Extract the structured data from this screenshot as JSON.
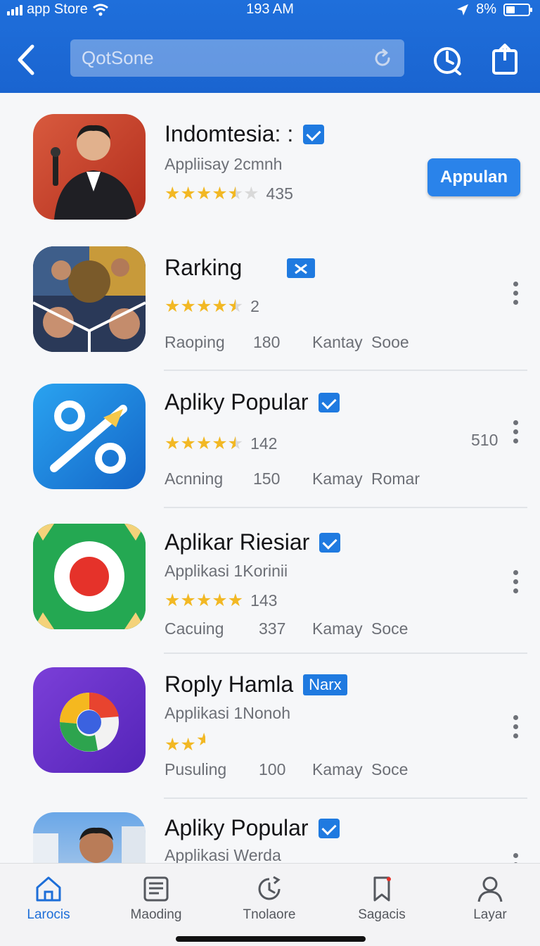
{
  "status_bar": {
    "carrier": "app Store",
    "time": "193 AM",
    "battery": "8%"
  },
  "header": {
    "search_placeholder": "QotSone"
  },
  "apps": [
    {
      "title": "Indomtesia: :",
      "subtitle": "Appliisay  2cmnh",
      "stars": 4.5,
      "rating_count": "435",
      "button": "Appulan",
      "badge": "check"
    },
    {
      "title": "Rarking",
      "stars": 4.5,
      "rating_count": "2",
      "badge": "x-tag",
      "meta": [
        "Raoping",
        "180",
        "Kantay",
        "Sooe"
      ]
    },
    {
      "title": "Apliky Popular",
      "stars": 4.5,
      "rating_count": "142",
      "right_value": "510",
      "badge": "check",
      "meta": [
        "Acnning",
        "150",
        "Kamay",
        "Romar"
      ]
    },
    {
      "title": "Aplikar Riesiar",
      "subtitle": "Applikasi  1Korinii",
      "stars": 5,
      "rating_count": "143",
      "badge": "check",
      "meta": [
        "Cacuing",
        "337",
        "Kamay",
        "Soce"
      ]
    },
    {
      "title": "Roply Hamla",
      "subtitle": "Applikasi  1Nonoh",
      "stars": 2.5,
      "badge_text": "Narx",
      "meta": [
        "Pusuling",
        "100",
        "Kamay",
        "Soce"
      ]
    },
    {
      "title": "Apliky Popular",
      "subtitle": "Applikasi  Werda",
      "badge": "check"
    }
  ],
  "tabs": [
    {
      "label": "Larocis",
      "icon": "home-icon",
      "active": true
    },
    {
      "label": "Maoding",
      "icon": "document-icon"
    },
    {
      "label": "Tnolaore",
      "icon": "history-icon"
    },
    {
      "label": "Sagacis",
      "icon": "bookmark-icon"
    },
    {
      "label": "Layar",
      "icon": "person-icon"
    }
  ],
  "colors": {
    "header_blue": "#1f6fdb",
    "accent": "#1f7ae0",
    "star": "#f2b824"
  }
}
